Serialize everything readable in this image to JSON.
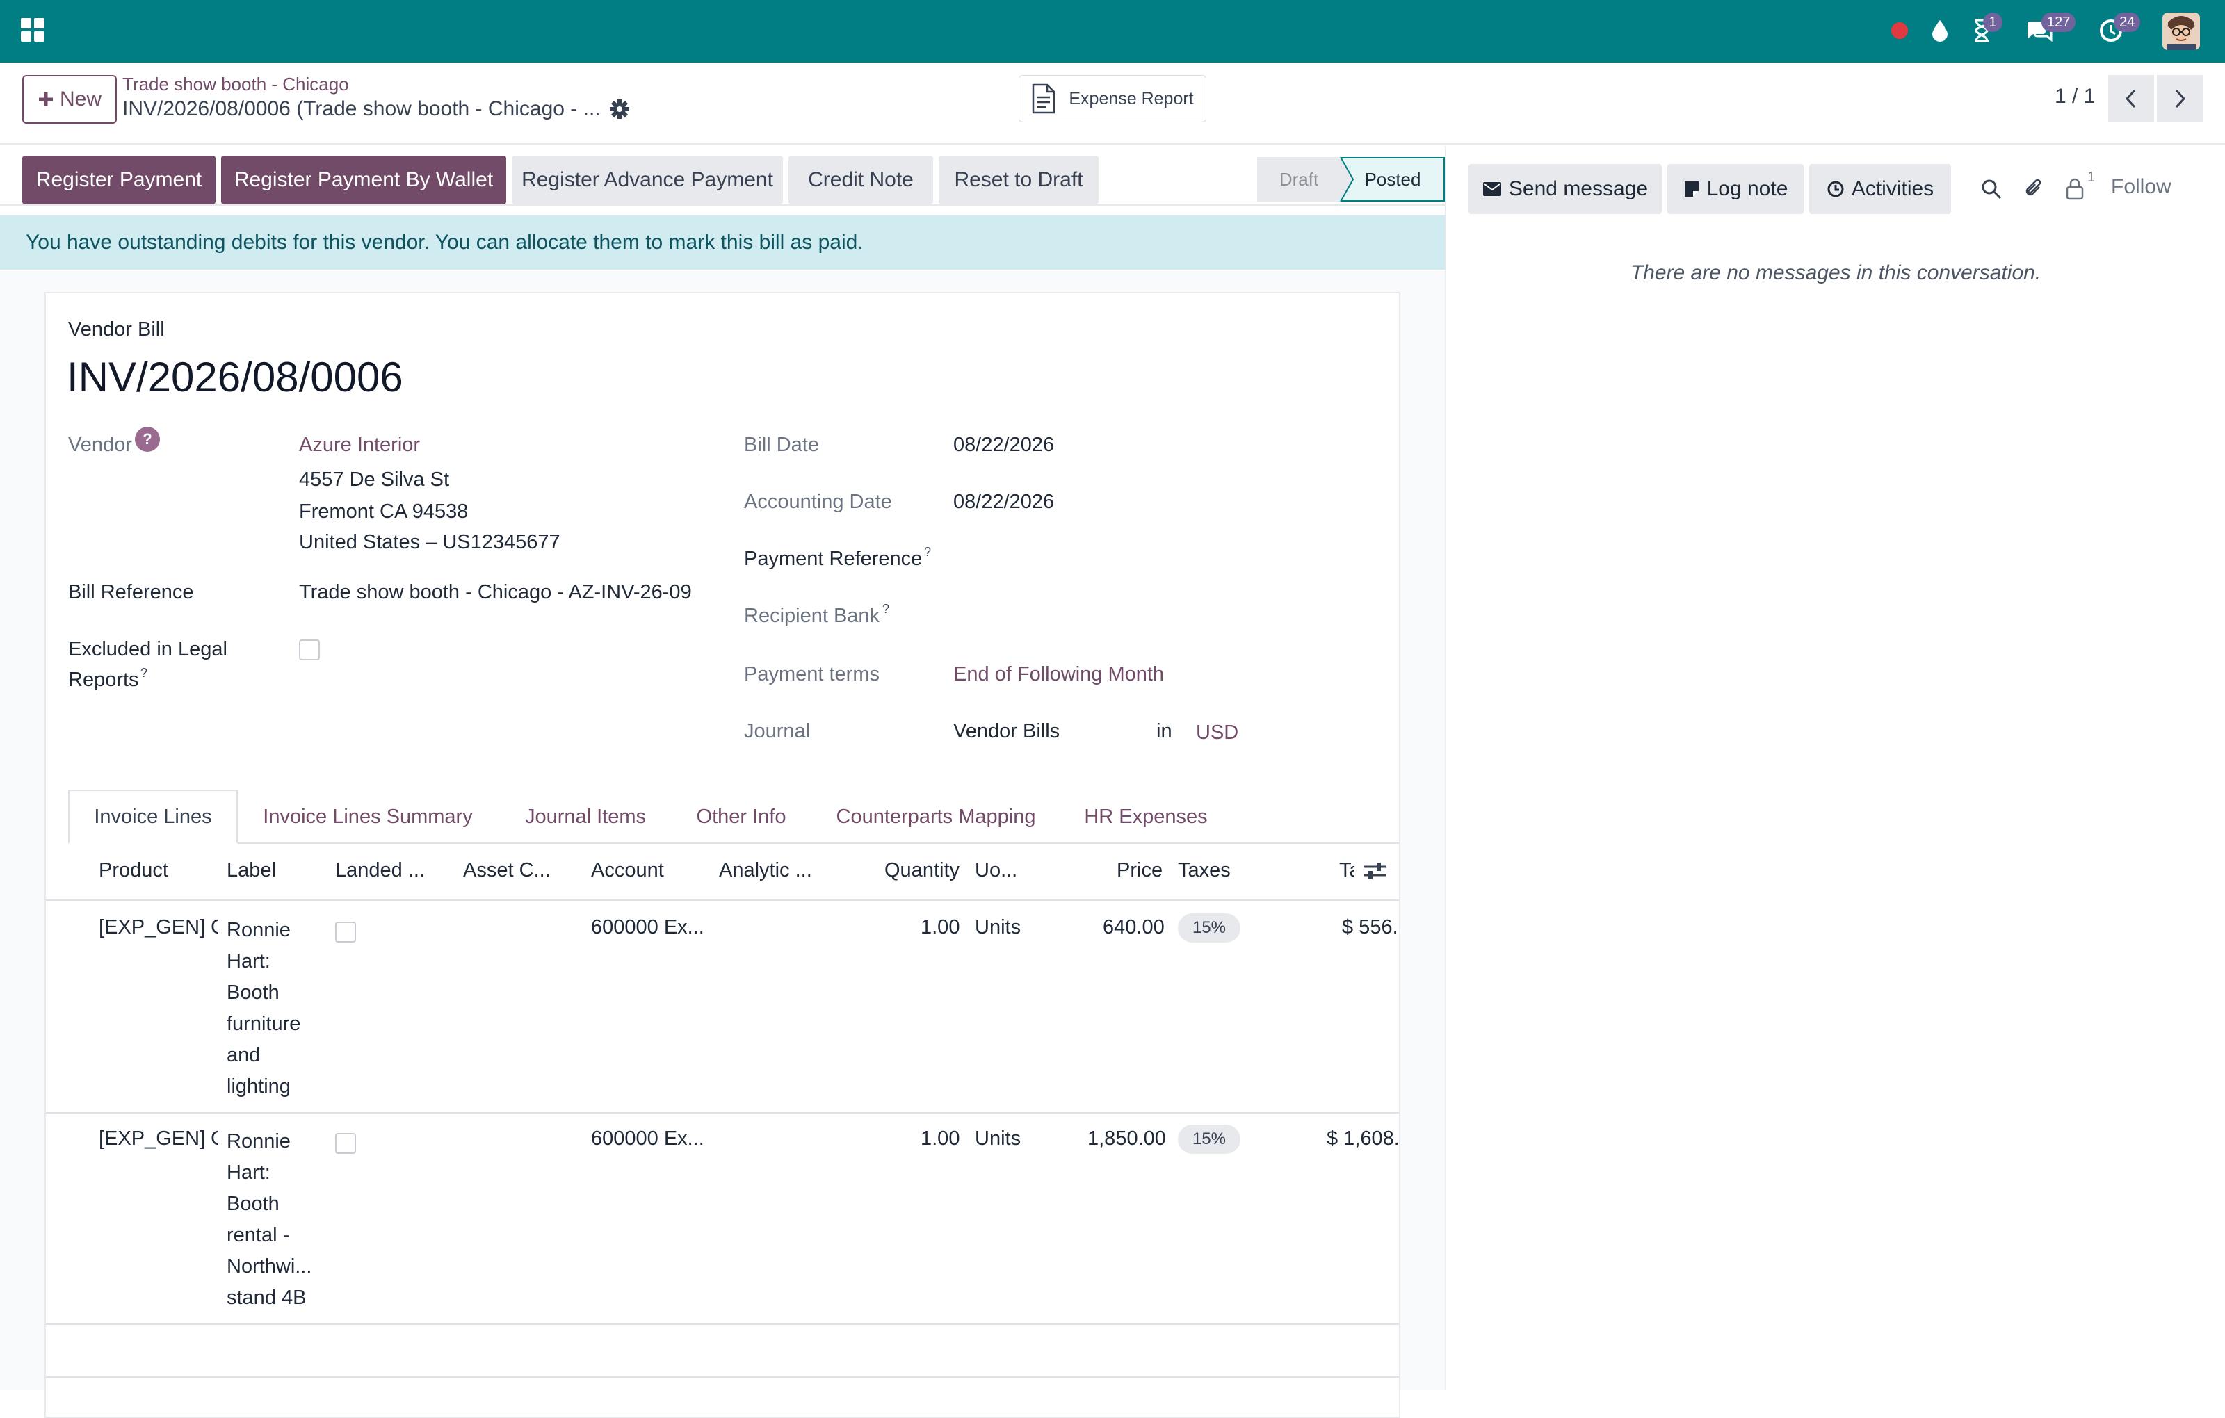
{
  "navbar": {
    "badges": {
      "activities": "1",
      "messages": "127",
      "updates": "24"
    },
    "colors": {
      "bar": "#017e84",
      "badge": "#71639e"
    },
    "icons": [
      "apps-icon",
      "record-dot-icon",
      "drop-icon",
      "hourglass-icon",
      "chat-icon",
      "clock-icon",
      "avatar"
    ]
  },
  "control_panel": {
    "new_label": "New",
    "breadcrumb_parent": "Trade show booth - Chicago",
    "record_title": "INV/2026/08/0006 (Trade show booth - Chicago - ...",
    "expense_report_label": "Expense Report",
    "pager": "1 / 1"
  },
  "status_buttons": {
    "register_payment": "Register Payment",
    "register_payment_wallet": "Register Payment By Wallet",
    "register_advance": "Register Advance Payment",
    "credit_note": "Credit Note",
    "reset_to_draft": "Reset to Draft",
    "stage_draft": "Draft",
    "stage_posted": "Posted"
  },
  "alert": {
    "text": "You have outstanding debits for this vendor. You can allocate them to mark this bill as paid."
  },
  "form": {
    "doc_type": "Vendor Bill",
    "name": "INV/2026/08/0006",
    "vendor_label": "Vendor",
    "vendor_help": "?",
    "vendor_name": "Azure Interior",
    "vendor_addr1": "4557 De Silva St",
    "vendor_addr2": "Fremont CA 94538",
    "vendor_addr3": "United States – US12345677",
    "bill_ref_label": "Bill Reference",
    "bill_ref_value": "Trade show booth - Chicago - AZ-INV-26-09",
    "excluded_label_1": "Excluded in Legal",
    "excluded_label_2": "Reports",
    "bill_date_label": "Bill Date",
    "bill_date": "08/22/2026",
    "acc_date_label": "Accounting Date",
    "acc_date": "08/22/2026",
    "payment_ref_label": "Payment Reference",
    "recipient_bank_label": "Recipient Bank",
    "payment_terms_label": "Payment terms",
    "payment_terms": "End of Following Month",
    "journal_label": "Journal",
    "journal": "Vendor Bills",
    "journal_in": "in",
    "currency": "USD",
    "help_mark": "?"
  },
  "tabs": [
    "Invoice Lines",
    "Invoice Lines Summary",
    "Journal Items",
    "Other Info",
    "Counterparts Mapping",
    "HR Expenses"
  ],
  "table": {
    "headers": [
      "Product",
      "Label",
      "Landed ...",
      "Asset C...",
      "Account",
      "Analytic ...",
      "Quantity",
      "Uo...",
      "Price",
      "Taxes",
      "Ta"
    ],
    "rows": [
      {
        "product": "[EXP_GEN] O",
        "label_lines": [
          "Ronnie",
          "Hart:",
          "Booth",
          "furniture",
          "and",
          "lighting"
        ],
        "account": "600000 Ex...",
        "quantity": "1.00",
        "uom": "Units",
        "price": "640.00",
        "tax": "15%",
        "total": "$ 556."
      },
      {
        "product": "[EXP_GEN] O",
        "label_lines": [
          "Ronnie",
          "Hart:",
          "Booth",
          "rental -",
          "Northwi...",
          "stand 4B"
        ],
        "account": "600000 Ex...",
        "quantity": "1.00",
        "uom": "Units",
        "price": "1,850.00",
        "tax": "15%",
        "total": "$ 1,608."
      }
    ]
  },
  "chatter": {
    "send_message": "Send message",
    "log_note": "Log note",
    "activities": "Activities",
    "followers_count": "1",
    "follow": "Follow",
    "empty": "There are no messages in this conversation."
  }
}
